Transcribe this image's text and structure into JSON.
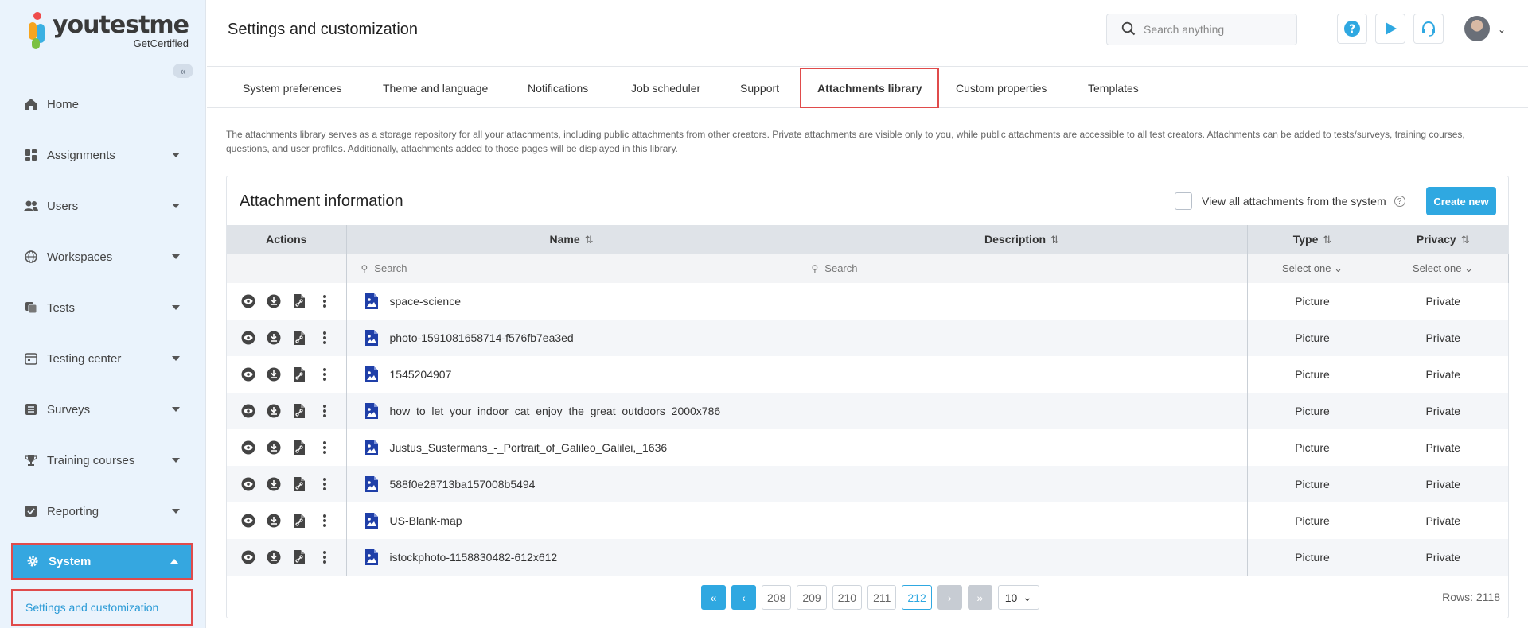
{
  "brand": {
    "name": "youtestme",
    "tagline": "GetCertified"
  },
  "sidebar": {
    "items": [
      {
        "label": "Home",
        "icon": "home-icon"
      },
      {
        "label": "Assignments",
        "icon": "grid-icon"
      },
      {
        "label": "Users",
        "icon": "users-icon"
      },
      {
        "label": "Workspaces",
        "icon": "globe-icon"
      },
      {
        "label": "Tests",
        "icon": "copy-icon"
      },
      {
        "label": "Testing center",
        "icon": "calendar-icon"
      },
      {
        "label": "Surveys",
        "icon": "list-icon"
      },
      {
        "label": "Training courses",
        "icon": "trophy-icon"
      },
      {
        "label": "Reporting",
        "icon": "checkbox-icon"
      },
      {
        "label": "System",
        "icon": "gear-icon"
      }
    ],
    "sub_item": "Settings and customization"
  },
  "header": {
    "title": "Settings and customization",
    "search_placeholder": "Search anything"
  },
  "tabs": [
    "System preferences",
    "Theme and language",
    "Notifications",
    "Job scheduler",
    "Support",
    "Attachments library",
    "Custom properties",
    "Templates"
  ],
  "active_tab": "Attachments library",
  "description": "The attachments library serves as a storage repository for all your attachments, including public attachments from other creators. Private attachments are visible only to you, while public attachments are accessible to all test creators. Attachments can be added to tests/surveys, training courses, questions, and user profiles. Additionally, attachments added to those pages will be displayed in this library.",
  "card": {
    "title": "Attachment information",
    "view_all_label": "View all attachments from the system",
    "create_label": "Create new"
  },
  "table": {
    "columns": [
      "Actions",
      "Name",
      "Description",
      "Type",
      "Privacy"
    ],
    "filters": {
      "name": "Search",
      "description": "Search",
      "type": "Select one",
      "privacy": "Select one"
    },
    "rows": [
      {
        "name": "space-science",
        "description": "",
        "type": "Picture",
        "privacy": "Private"
      },
      {
        "name": "photo-1591081658714-f576fb7ea3ed",
        "description": "",
        "type": "Picture",
        "privacy": "Private"
      },
      {
        "name": "1545204907",
        "description": "",
        "type": "Picture",
        "privacy": "Private"
      },
      {
        "name": "how_to_let_your_indoor_cat_enjoy_the_great_outdoors_2000x786",
        "description": "",
        "type": "Picture",
        "privacy": "Private"
      },
      {
        "name": "Justus_Sustermans_-_Portrait_of_Galileo_Galilei,_1636",
        "description": "",
        "type": "Picture",
        "privacy": "Private"
      },
      {
        "name": "588f0e28713ba157008b5494",
        "description": "",
        "type": "Picture",
        "privacy": "Private"
      },
      {
        "name": "US-Blank-map",
        "description": "",
        "type": "Picture",
        "privacy": "Private"
      },
      {
        "name": "istockphoto-1158830482-612x612",
        "description": "",
        "type": "Picture",
        "privacy": "Private"
      }
    ]
  },
  "pagination": {
    "pages": [
      "208",
      "209",
      "210",
      "211",
      "212"
    ],
    "current": "212",
    "page_size": "10",
    "rows_label": "Rows: 2118"
  }
}
